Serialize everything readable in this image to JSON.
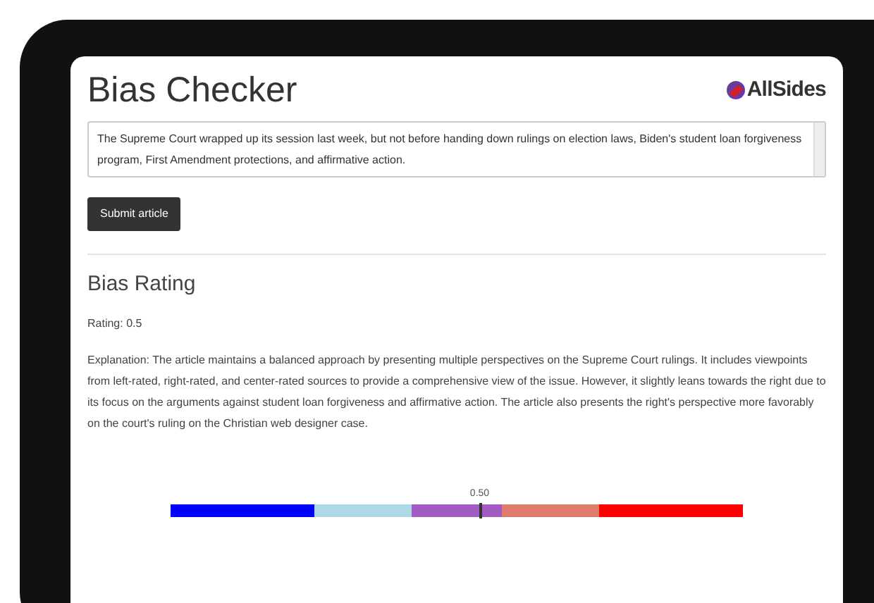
{
  "header": {
    "title": "Bias Checker",
    "logo_text": "AllSides"
  },
  "article_input": {
    "value": "The Supreme Court wrapped up its session last week, but not before handing down rulings on election laws, Biden's student loan forgiveness program, First Amendment protections, and affirmative action."
  },
  "submit_button": "Submit article",
  "bias_rating": {
    "heading": "Bias Rating",
    "rating": "Rating: 0.5",
    "explanation": "Explanation: The article maintains a balanced approach by presenting multiple perspectives on the Supreme Court rulings. It includes viewpoints from left-rated, right-rated, and center-rated sources to provide a comprehensive view of the issue. However, it slightly leans towards the right due to its focus on the arguments against student loan forgiveness and affirmative action. The article also presents the right's perspective more favorably on the court's ruling on the Christian web designer case."
  },
  "bias_scale": {
    "marker_label": "0.50",
    "level": 0.54,
    "segments": [
      {
        "color": "#0000ff"
      },
      {
        "color": "#add8e6"
      },
      {
        "color": "#a25cc4"
      },
      {
        "color": "#e07b6b"
      },
      {
        "color": "#ff0000"
      }
    ]
  }
}
